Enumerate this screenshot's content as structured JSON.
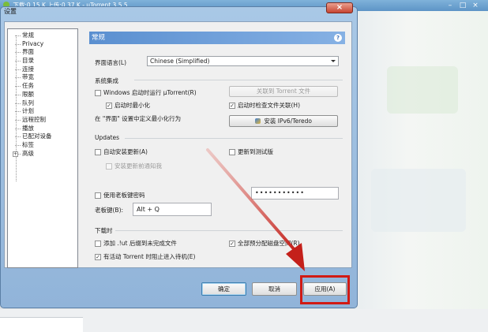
{
  "main_window": {
    "title": "下载:0.15 K 上传:0.37 K - µTorrent 3.5.5",
    "controls": [
      "–",
      "□",
      "×"
    ]
  },
  "dialog": {
    "title": "设置",
    "close_label": "×",
    "tree": [
      {
        "label": "常规",
        "expandable": false
      },
      {
        "label": "Privacy",
        "expandable": false
      },
      {
        "label": "界面",
        "expandable": false
      },
      {
        "label": "目录",
        "expandable": false
      },
      {
        "label": "连接",
        "expandable": false
      },
      {
        "label": "带宽",
        "expandable": false
      },
      {
        "label": "任务",
        "expandable": false
      },
      {
        "label": "限额",
        "expandable": false
      },
      {
        "label": "队列",
        "expandable": false
      },
      {
        "label": "计划",
        "expandable": false
      },
      {
        "label": "远程控制",
        "expandable": false
      },
      {
        "label": "播放",
        "expandable": false
      },
      {
        "label": "已配对设备",
        "expandable": false
      },
      {
        "label": "标签",
        "expandable": false
      },
      {
        "label": "高级",
        "expandable": true
      }
    ],
    "panel": {
      "title": "常规",
      "help": "?",
      "language_label": "界面语言(L)",
      "language_value": "Chinese (Simplified)",
      "system_section": "系统集成",
      "start_with_windows": "Windows 启动时运行 µTorrent(R)",
      "start_minimized": "启动时最小化",
      "associate_button": "关联到 Torrent 文件",
      "check_association": "启动时检查文件关联(H)",
      "minimize_behavior": "在 \"界面\" 设置中定义最小化行为",
      "ipv6_button": "安装 IPv6/Teredo",
      "updates_section": "Updates",
      "auto_update": "自动安装更新(A)",
      "beta_update": "更新到测试版",
      "anonymous_info": "安装更新前通知我",
      "boss_key_checkbox": "使用老板键密码",
      "boss_key_label": "老板键(B):",
      "boss_key_value": "Alt + Q",
      "password_value": "•••••••••••",
      "download_section": "下载时",
      "append_ut": "添加 .!ut 后缀到未完成文件",
      "preallocate": "全部预分配磁盘空间(R)",
      "prevent_standby": "有活动 Torrent 时阻止进入待机(E)"
    },
    "buttons": {
      "ok": "确定",
      "cancel": "取消",
      "apply": "应用(A)"
    }
  },
  "colors": {
    "highlight": "#d11a14",
    "arrow": "#c4201a"
  }
}
